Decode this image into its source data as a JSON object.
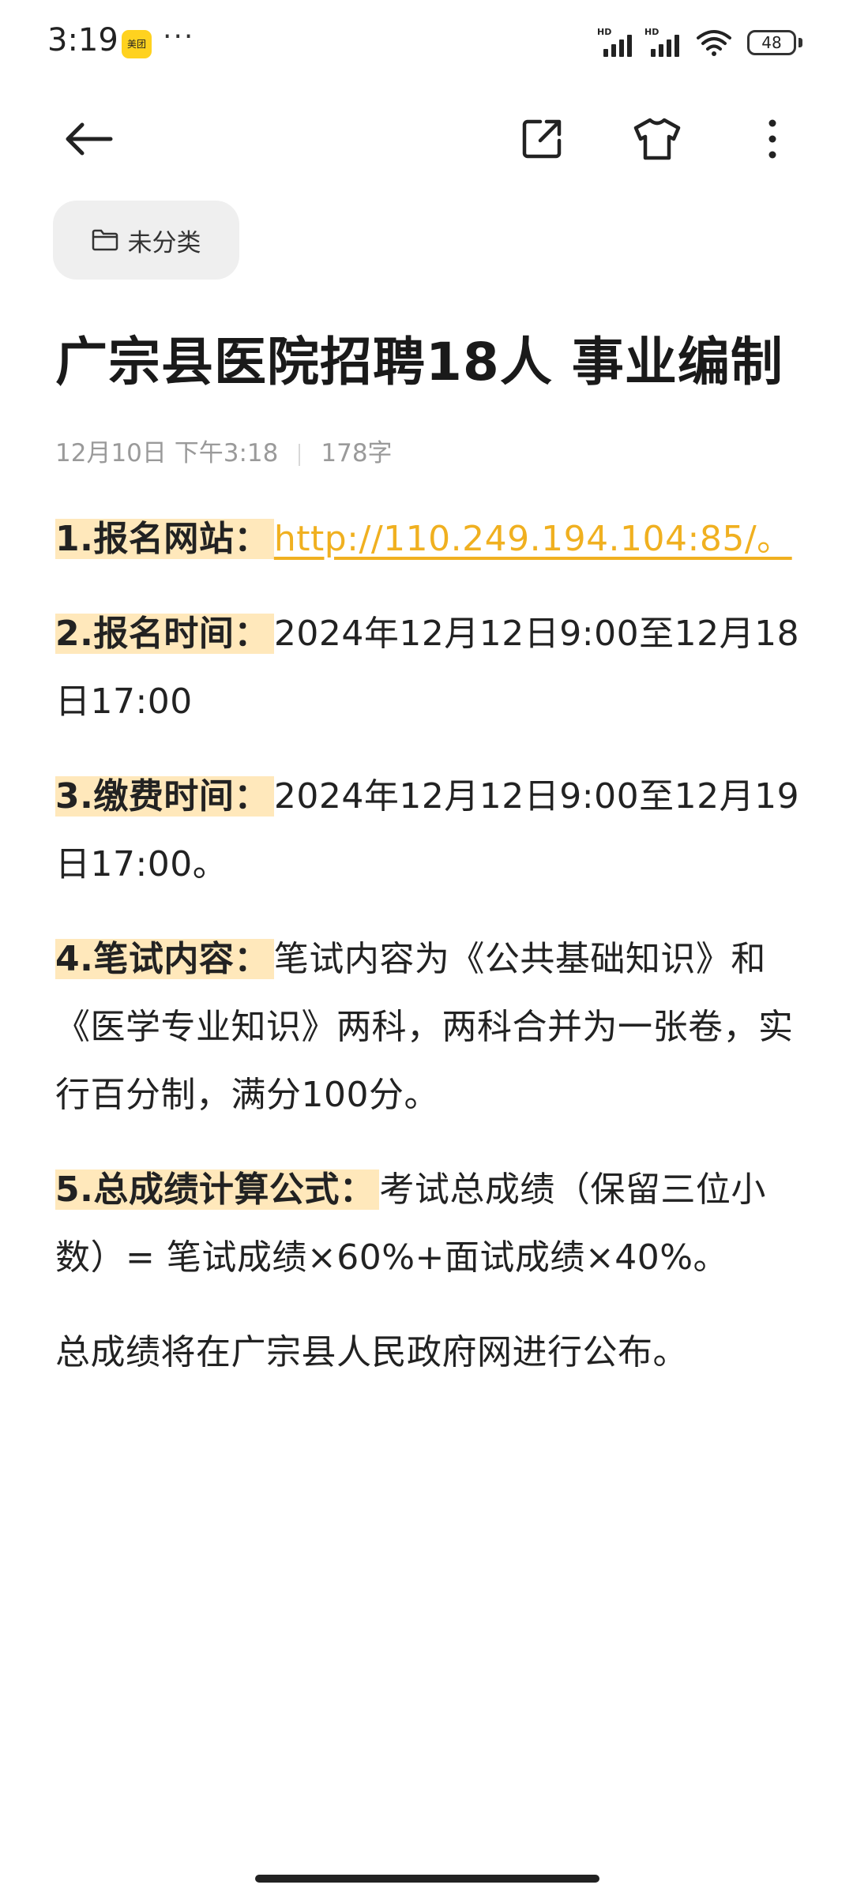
{
  "status_bar": {
    "time": "3:19",
    "app_badge": "美团",
    "more": "···",
    "signal_label": "HD",
    "battery": "48"
  },
  "toolbar": {
    "back_icon": "back-arrow-icon",
    "share_icon": "share-icon",
    "theme_icon": "tshirt-icon",
    "more_icon": "more-vertical-icon"
  },
  "note": {
    "category": "未分类",
    "title": "广宗县医院招聘18人 事业编制",
    "date": "12月10日 下午3:18",
    "word_count": "178字",
    "items": [
      {
        "label": "1.报名网站：",
        "link": "http://110.249.194.104:85/。"
      },
      {
        "label": "2.报名时间：",
        "text": "2024年12月12日9:00至12月18日17:00"
      },
      {
        "label": "3.缴费时间：",
        "text": "2024年12月12日9:00至12月19日17:00。"
      },
      {
        "label": "4.笔试内容：",
        "text": "笔试内容为《公共基础知识》和《医学专业知识》两科，两科合并为一张卷，实行百分制，满分100分。"
      },
      {
        "label": "5.总成绩计算公式：",
        "text": "考试总成绩（保留三位小数）= 笔试成绩×60%+面试成绩×40%。"
      }
    ],
    "footer": "总成绩将在广宗县人民政府网进行公布。"
  },
  "colors": {
    "highlight": "#ffe8bb",
    "link": "#f0b020",
    "chip_bg": "#efefef"
  }
}
